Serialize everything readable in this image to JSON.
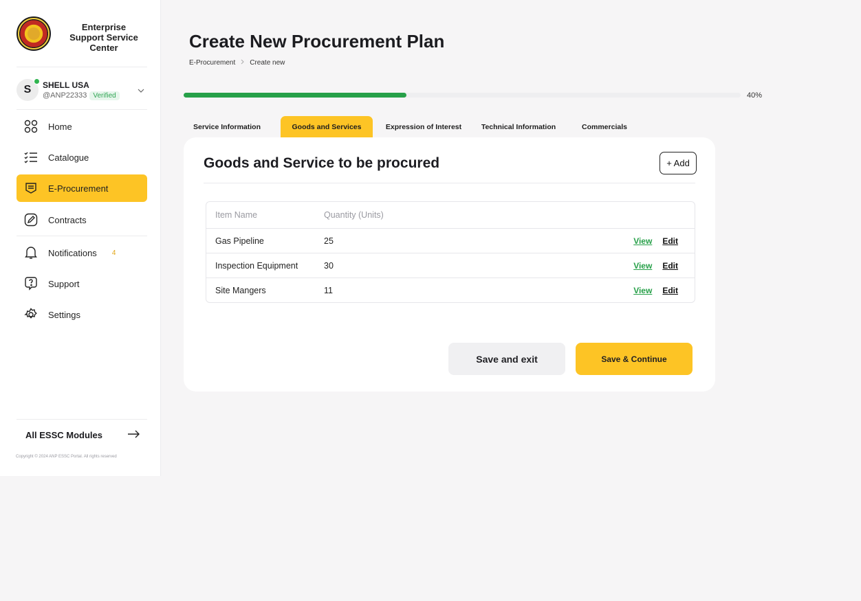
{
  "brand": {
    "name": "Enterprise Support Service Center"
  },
  "account": {
    "avatar_letter": "S",
    "name": "SHELL USA",
    "handle": "@ANP22333",
    "verified_label": "Verified"
  },
  "sidebar": {
    "items": [
      {
        "label": "Home",
        "icon": "grid-icon"
      },
      {
        "label": "Catalogue",
        "icon": "list-icon"
      },
      {
        "label": "E-Procurement",
        "icon": "document-icon",
        "active": true
      },
      {
        "label": "Contracts",
        "icon": "pen-icon"
      },
      {
        "label": "Notifications",
        "icon": "bell-icon",
        "badge": "4"
      },
      {
        "label": "Support",
        "icon": "help-chat-icon"
      },
      {
        "label": "Settings",
        "icon": "gear-icon"
      }
    ],
    "modules_label": "All ESSC Modules",
    "copyright": "Copyright © 2024 ANP ESSC Portal. All rights reserved"
  },
  "page": {
    "title": "Create New Procurement Plan",
    "breadcrumb": [
      "E-Procurement",
      "Create new"
    ]
  },
  "progress": {
    "percent": 40,
    "label": "40%"
  },
  "tabs": [
    {
      "label": "Service Information",
      "active": false
    },
    {
      "label": "Goods and Services",
      "active": true
    },
    {
      "label": "Expression of Interest",
      "active": false
    },
    {
      "label": "Technical Information",
      "active": false
    },
    {
      "label": "Commercials",
      "active": false
    }
  ],
  "card": {
    "title": "Goods and Service to be procured",
    "add_label": "+ Add",
    "table": {
      "headers": [
        "Item Name",
        "Quantity (Units)"
      ],
      "rows": [
        {
          "item": "Gas Pipeline",
          "qty": "25"
        },
        {
          "item": "Inspection Equipment",
          "qty": "30"
        },
        {
          "item": "Site Mangers",
          "qty": "11"
        }
      ],
      "view_label": "View",
      "edit_label": "Edit"
    },
    "save_exit_label": "Save and exit",
    "save_continue_label": "Save & Continue"
  },
  "colors": {
    "accent": "#fdc425",
    "success": "#27a049"
  }
}
